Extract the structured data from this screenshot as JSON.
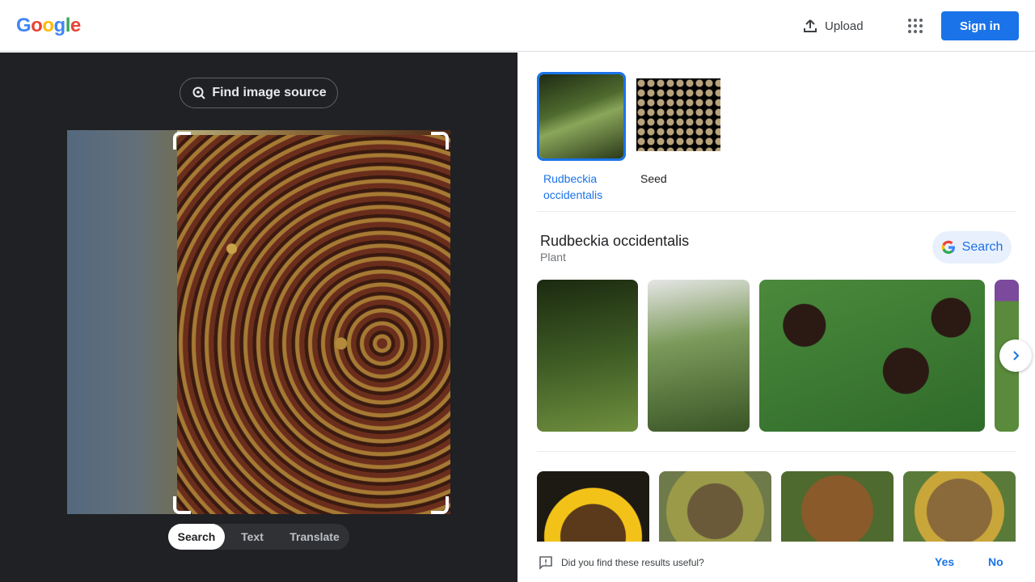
{
  "header": {
    "logo_text": "Google",
    "upload_label": "Upload",
    "apps_icon": "apps-grid-icon",
    "sign_in_label": "Sign in"
  },
  "lens": {
    "find_source_label": "Find image source",
    "modes": [
      {
        "label": "Search",
        "active": true
      },
      {
        "label": "Text",
        "active": false
      },
      {
        "label": "Translate",
        "active": false
      }
    ]
  },
  "results": {
    "chips": [
      {
        "label": "Rudbeckia occidentalis",
        "selected": true
      },
      {
        "label": "Seed",
        "selected": false
      }
    ],
    "knowledge": {
      "title": "Rudbeckia occidentalis",
      "subtitle": "Plant",
      "search_label": "Search"
    },
    "feedback": {
      "question": "Did you find these results useful?",
      "yes": "Yes",
      "no": "No"
    }
  },
  "colors": {
    "accent": "#1a73e8",
    "panel_dark": "#202124"
  }
}
